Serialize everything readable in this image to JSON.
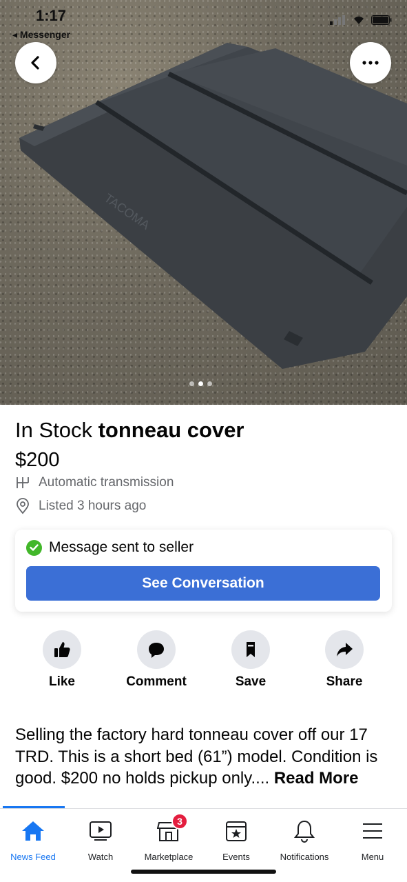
{
  "status_bar": {
    "time": "1:17",
    "back_app": "◂ Messenger"
  },
  "hero": {
    "image_desc": "tonneau-cover-photo",
    "image_text": "TACOMA",
    "page_indicator": {
      "count": 3,
      "active": 2
    }
  },
  "listing": {
    "title_prefix": "In Stock ",
    "title_main": "tonneau cover",
    "price": "$200",
    "transmission": "Automatic transmission",
    "listed": "Listed 3 hours ago"
  },
  "message_card": {
    "status": "Message sent to seller",
    "button": "See Conversation",
    "colors": {
      "button": "#3b6fd6",
      "check": "#42b72a"
    }
  },
  "actions": [
    {
      "label": "Like",
      "icon": "thumbs-up-icon"
    },
    {
      "label": "Comment",
      "icon": "comment-icon"
    },
    {
      "label": "Save",
      "icon": "bookmark-icon"
    },
    {
      "label": "Share",
      "icon": "share-icon"
    }
  ],
  "description": {
    "text": "Selling the factory hard tonneau cover off our 17 TRD.  This is a short bed (61”) model. Condition is good. $200 no holds pickup only.... ",
    "read_more": "Read More"
  },
  "tabbar": {
    "tabs": [
      {
        "label": "News Feed",
        "icon": "home-icon",
        "active": true
      },
      {
        "label": "Watch",
        "icon": "watch-icon"
      },
      {
        "label": "Marketplace",
        "icon": "marketplace-icon",
        "badge": "3"
      },
      {
        "label": "Events",
        "icon": "events-icon"
      },
      {
        "label": "Notifications",
        "icon": "bell-icon"
      },
      {
        "label": "Menu",
        "icon": "menu-icon"
      }
    ],
    "accent": "#1877f2"
  }
}
